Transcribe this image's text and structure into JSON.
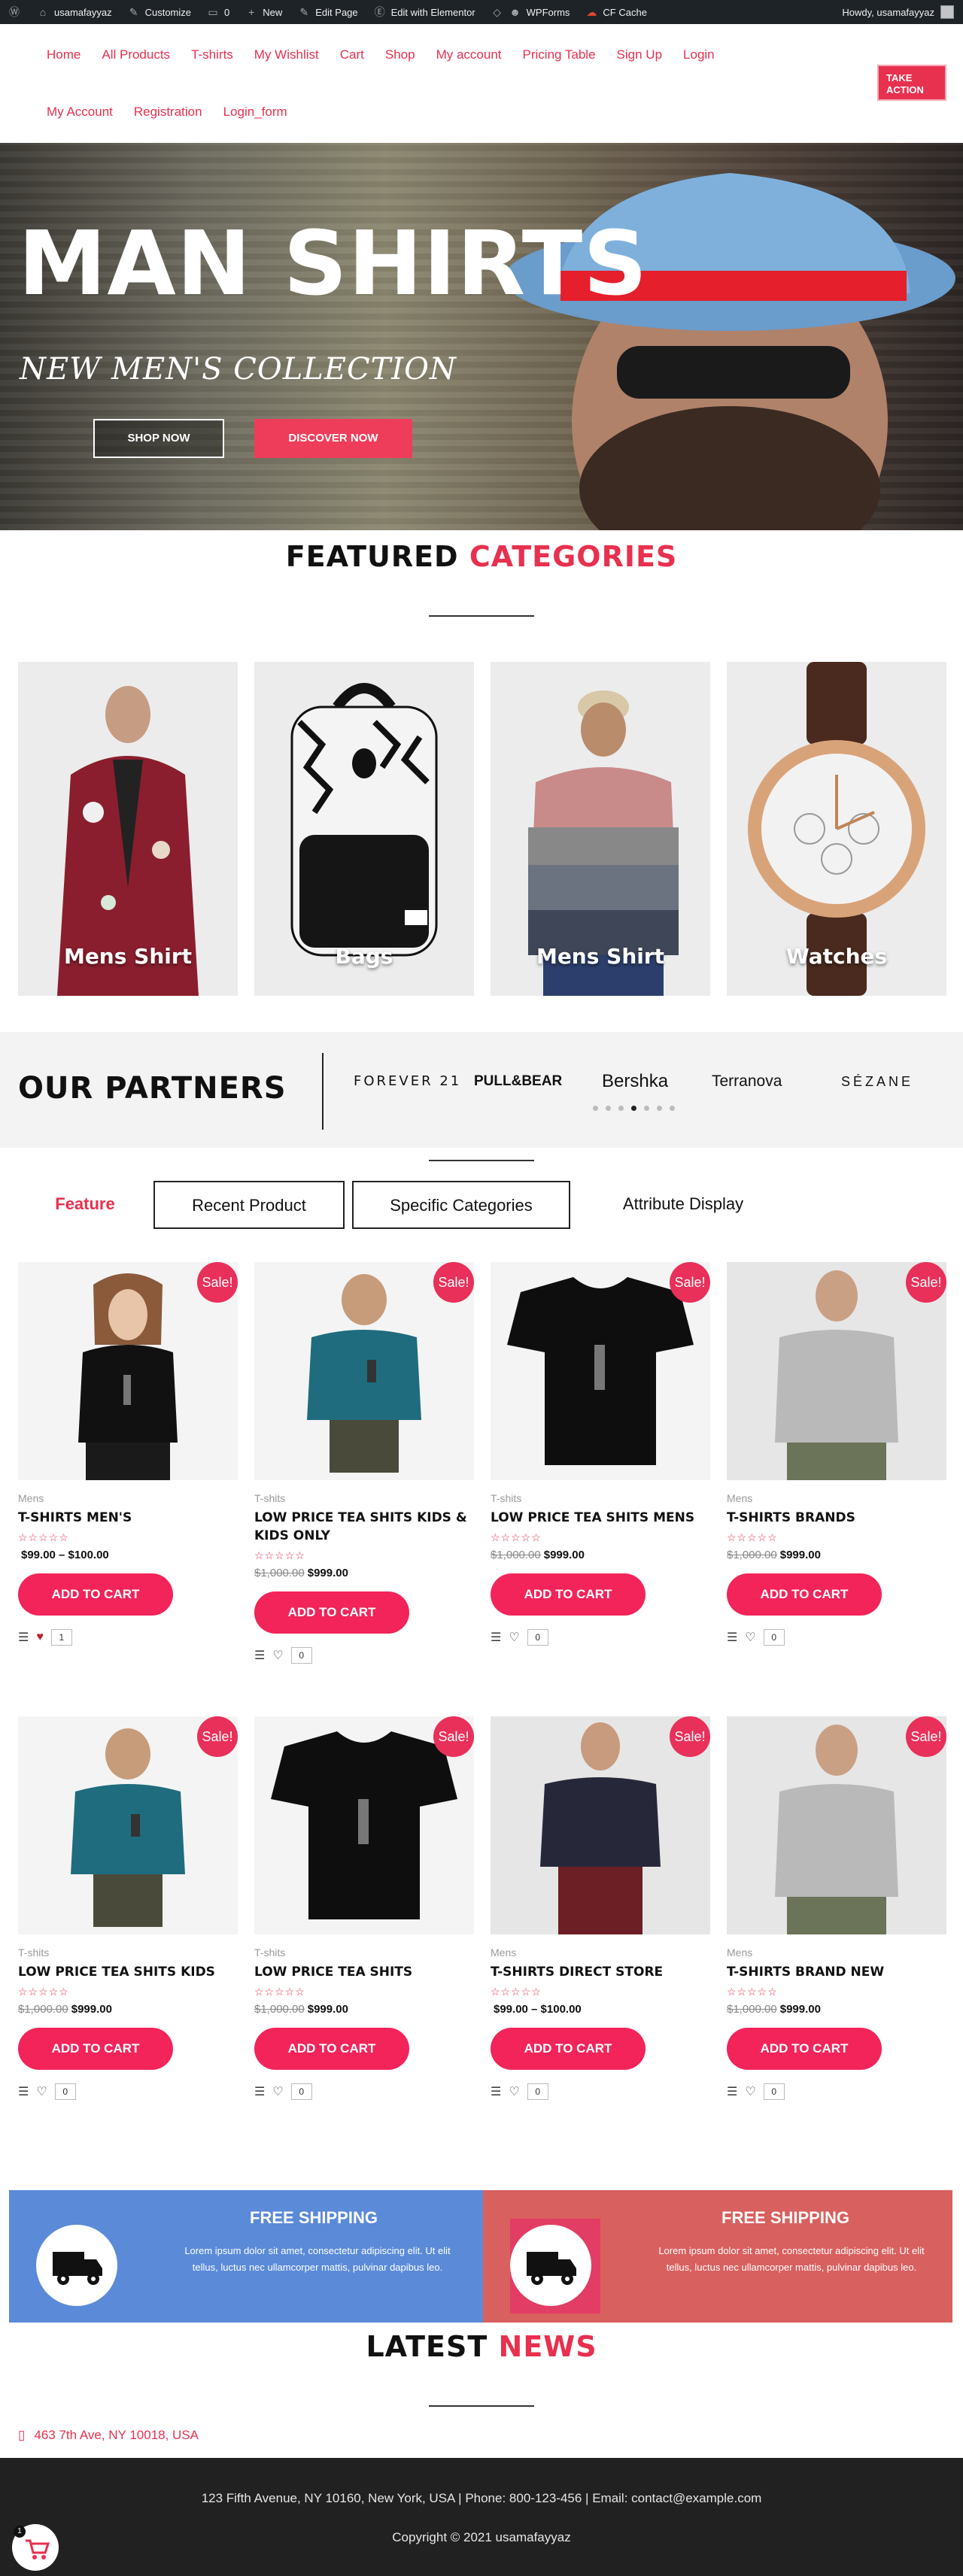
{
  "admin_bar": {
    "site_name": "usamafayyaz",
    "customize": "Customize",
    "comments_count": "0",
    "new": "New",
    "edit_page": "Edit Page",
    "edit_elementor": "Edit with Elementor",
    "wpforms": "WPForms",
    "cf_cache": "CF Cache",
    "howdy": "Howdy, usamafayyaz"
  },
  "nav": {
    "row1": [
      "Home",
      "All Products",
      "T-shirts",
      "My Wishlist",
      "Cart",
      "Shop",
      "My account",
      "Pricing Table",
      "Sign Up",
      "Login"
    ],
    "row2": [
      "My Account",
      "Registration",
      "Login_form"
    ],
    "take_action": "TAKE ACTION"
  },
  "hero": {
    "title": "MAN SHIRTS",
    "subtitle": "NEW MEN'S COLLECTION",
    "btn_shop": "SHOP NOW",
    "btn_discover": "DISCOVER NOW"
  },
  "featured": {
    "title_a": "FEATURED",
    "title_b": "CATEGORIES",
    "categories": [
      "Mens Shirt",
      "Bags",
      "Mens Shirt",
      "Watches"
    ]
  },
  "partners": {
    "title": "OUR PARTNERS",
    "logos": [
      "FOREVER 21",
      "PULL&BEAR",
      "Bershka",
      "Terranova",
      "SÉZANE"
    ]
  },
  "tabs": [
    "Feature",
    "Recent Product",
    "Specific Categories",
    "Attribute Display"
  ],
  "products": [
    {
      "cat": "Mens",
      "name": "T-SHIRTS MEN'S",
      "old": "",
      "price": "$99.00 – $100.00",
      "sale": "Sale!",
      "count": "1"
    },
    {
      "cat": "T-shits",
      "name": "LOW PRICE TEA SHITS KIDS & KIDS ONLY",
      "old": "$1,000.00",
      "price": "$999.00",
      "sale": "Sale!",
      "count": "0"
    },
    {
      "cat": "T-shits",
      "name": "LOW PRICE TEA SHITS MENS",
      "old": "$1,000.00",
      "price": "$999.00",
      "sale": "Sale!",
      "count": "0"
    },
    {
      "cat": "Mens",
      "name": "T-SHIRTS BRANDS",
      "old": "$1,000.00",
      "price": "$999.00",
      "sale": "Sale!",
      "count": "0"
    },
    {
      "cat": "T-shits",
      "name": "LOW PRICE TEA SHITS KIDS",
      "old": "$1,000.00",
      "price": "$999.00",
      "sale": "Sale!",
      "count": "0"
    },
    {
      "cat": "T-shits",
      "name": "LOW PRICE TEA SHITS",
      "old": "$1,000.00",
      "price": "$999.00",
      "sale": "Sale!",
      "count": "0"
    },
    {
      "cat": "Mens",
      "name": "T-SHIRTS DIRECT STORE",
      "old": "",
      "price": "$99.00 – $100.00",
      "sale": "Sale!",
      "count": "0"
    },
    {
      "cat": "Mens",
      "name": "T-SHIRTS BRAND NEW",
      "old": "$1,000.00",
      "price": "$999.00",
      "sale": "Sale!",
      "count": "0"
    }
  ],
  "add_to_cart": "ADD TO CART",
  "stars": "☆☆☆☆☆",
  "shipping": [
    {
      "title": "FREE SHIPPING",
      "text": "Lorem ipsum dolor sit amet, consectetur adipiscing elit. Ut elit tellus, luctus nec ullamcorper mattis, pulvinar dapibus leo.",
      "color": "#5b8ad8"
    },
    {
      "title": "FREE SHIPPING",
      "text": "Lorem ipsum dolor sit amet, consectetur adipiscing elit. Ut elit tellus, luctus nec ullamcorper mattis, pulvinar dapibus leo.",
      "color": "#d8605f"
    }
  ],
  "news": {
    "title_a": "LATEST",
    "title_b": "NEWS",
    "address": "463 7th Ave, NY 10018, USA"
  },
  "footer": {
    "line1": "123 Fifth Avenue, NY 10160, New York, USA | Phone: 800-123-456 | Email: contact@example.com",
    "line2": "Copyright © 2021 usamafayyaz",
    "cart_count": "1"
  },
  "colors": {
    "accent": "#e8304f",
    "admin_bar": "#1d2327",
    "footer": "#212121"
  }
}
